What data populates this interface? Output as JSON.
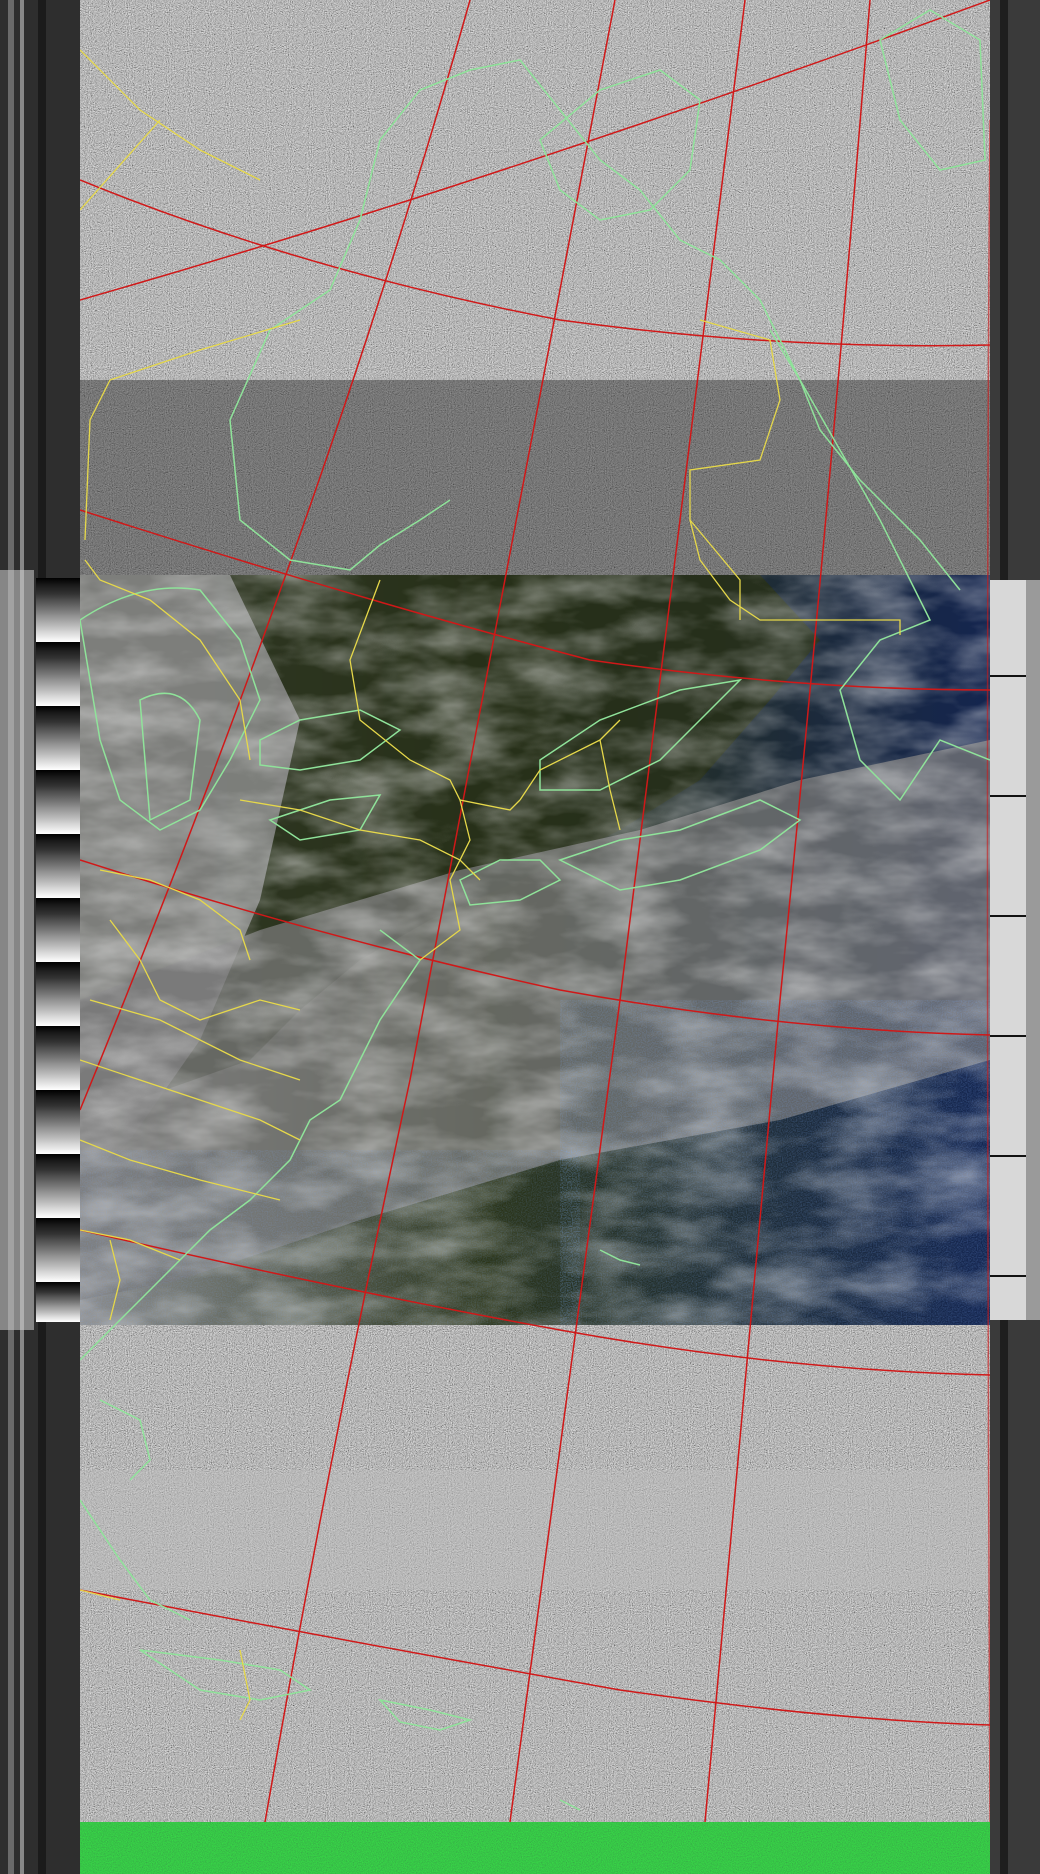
{
  "image": {
    "kind": "NOAA APT weather satellite image with map overlay",
    "colors": {
      "noise_dark": "#3a3a3a",
      "noise_light": "#bdbdbd",
      "ocean": "#14254f",
      "land_dark": "#2a3216",
      "cloud": "#c9c9c9",
      "coastline": "#8fe39a",
      "state_border": "#e6d84a",
      "graticule": "#d01818",
      "sync_green": "#0f5a16"
    }
  }
}
